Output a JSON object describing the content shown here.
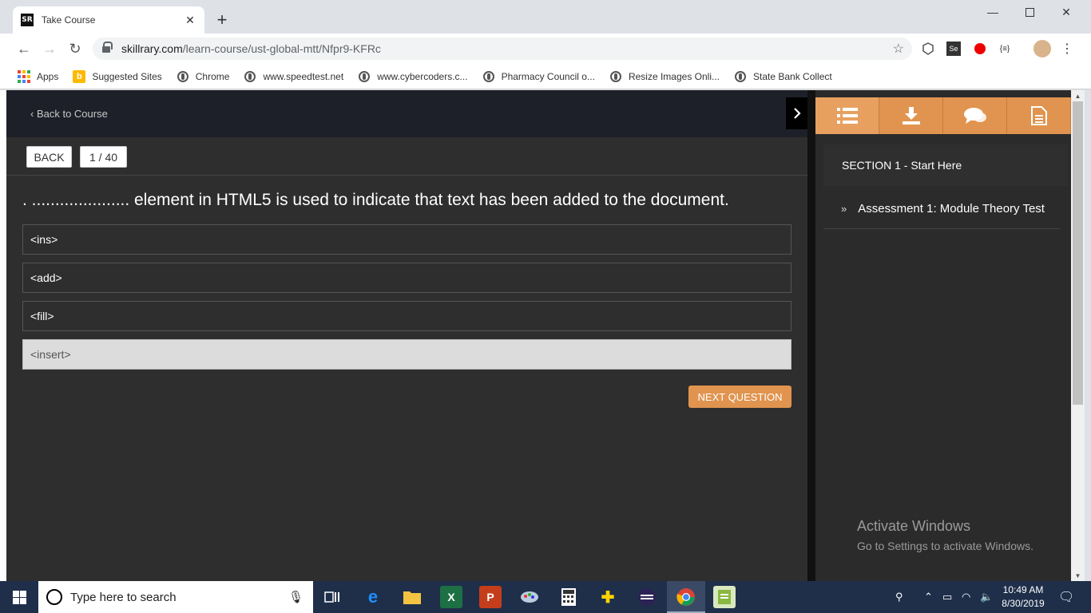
{
  "browser": {
    "tab_title": "Take Course",
    "favicon_text": "SR",
    "url_host": "skillrary.com",
    "url_path": "/learn-course/ust-global-mtt/Nfpr9-KFRc",
    "bookmarks": [
      {
        "label": "Apps",
        "icon": "apps-grid-icon"
      },
      {
        "label": "Suggested Sites",
        "icon": "bing-icon"
      },
      {
        "label": "Chrome",
        "icon": "globe-icon"
      },
      {
        "label": "www.speedtest.net",
        "icon": "globe-icon"
      },
      {
        "label": "www.cybercoders.c...",
        "icon": "globe-icon"
      },
      {
        "label": "Pharmacy Council o...",
        "icon": "globe-icon"
      },
      {
        "label": "Resize Images Onli...",
        "icon": "globe-icon"
      },
      {
        "label": "State Bank Collect",
        "icon": "globe-icon"
      }
    ]
  },
  "page": {
    "back_to_course": "‹ Back to Course",
    "back_button": "BACK",
    "counter": "1 / 40",
    "question": ". ..................... element in HTML5 is used to indicate that text has been added to the document.",
    "options": [
      {
        "label": "<ins>",
        "selected": false
      },
      {
        "label": "<add>",
        "selected": false
      },
      {
        "label": "<fill>",
        "selected": false
      },
      {
        "label": "<insert>",
        "selected": true
      }
    ],
    "next_button": "NEXT QUESTION"
  },
  "sidebar": {
    "tabs": [
      "list-icon",
      "download-icon",
      "chat-icon",
      "document-icon"
    ],
    "section_title": "SECTION 1 - Start Here",
    "lesson": "Assessment 1: Module Theory Test",
    "watermark_line1": "Activate Windows",
    "watermark_line2": "Go to Settings to activate Windows."
  },
  "taskbar": {
    "search_placeholder": "Type here to search",
    "time": "10:49 AM",
    "date": "8/30/2019"
  },
  "colors": {
    "accent": "#e0944f",
    "page_bg": "#2e2e2e",
    "header_bg": "#1e2029",
    "taskbar": "#1f2f4a"
  }
}
